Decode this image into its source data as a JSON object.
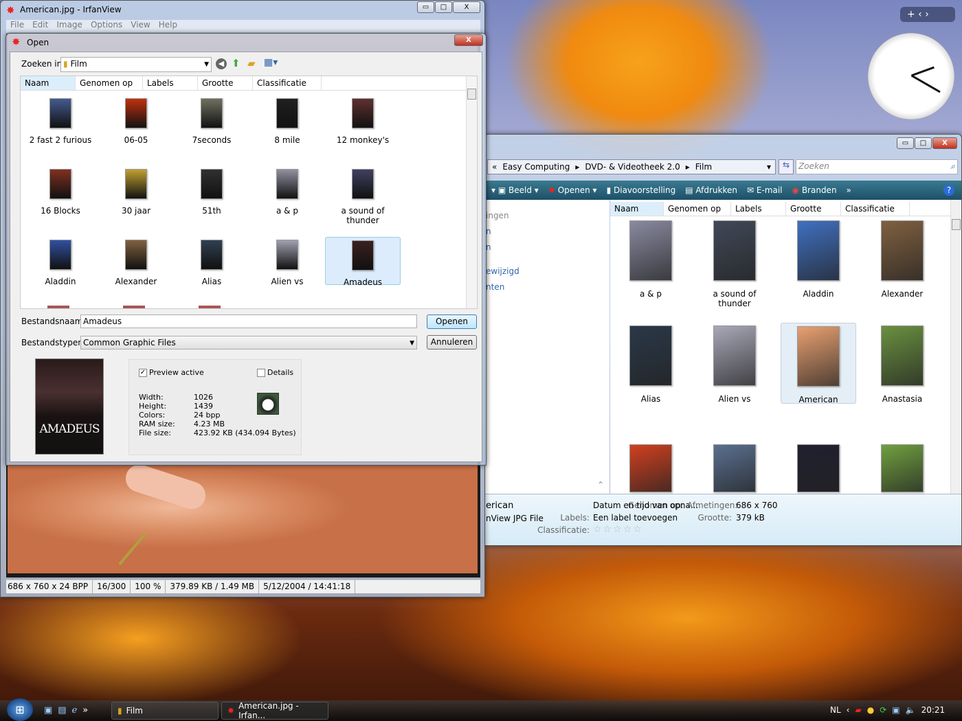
{
  "irfanview": {
    "title": "American.jpg - IrfanView",
    "menu": [
      "File",
      "Edit",
      "Image",
      "Options",
      "View",
      "Help"
    ],
    "status": [
      "686 x 760 x 24 BPP",
      "16/300",
      "100 %",
      "379.89 KB / 1.49 MB",
      "5/12/2004 / 14:41:18"
    ]
  },
  "open_dialog": {
    "title": "Open",
    "look_in_label": "Zoeken in:",
    "look_in_value": "Film",
    "columns": [
      "Naam",
      "Genomen op",
      "Labels",
      "Grootte",
      "Classificatie"
    ],
    "files": [
      {
        "name": "2 fast 2 furious",
        "color": "#445a90"
      },
      {
        "name": "06-05",
        "color": "#c03010"
      },
      {
        "name": "7seconds",
        "color": "#707060"
      },
      {
        "name": "8 mile",
        "color": "#202020"
      },
      {
        "name": "12 monkey's",
        "color": "#603030"
      },
      {
        "name": "16 Blocks",
        "color": "#803020"
      },
      {
        "name": "30 jaar",
        "color": "#c0a030"
      },
      {
        "name": "51th",
        "color": "#303030"
      },
      {
        "name": "a & p",
        "color": "#9090a0"
      },
      {
        "name": "a sound of thunder",
        "color": "#404060"
      },
      {
        "name": "Aladdin",
        "color": "#3050a0"
      },
      {
        "name": "Alexander",
        "color": "#806040"
      },
      {
        "name": "Alias",
        "color": "#304050"
      },
      {
        "name": "Alien vs",
        "color": "#a0a0b0"
      },
      {
        "name": "Amadeus",
        "color": "#3a2020",
        "selected": true
      }
    ],
    "filename_label": "Bestandsnaam:",
    "filename_value": "Amadeus",
    "filetype_label": "Bestandstypen:",
    "filetype_value": "Common Graphic Files",
    "open_button": "Openen",
    "cancel_button": "Annuleren",
    "preview_title": "AMADEUS",
    "preview_active_label": "Preview active",
    "preview_active": true,
    "details_label": "Details",
    "details": false,
    "info": [
      [
        "Width:",
        "1026"
      ],
      [
        "Height:",
        "1439"
      ],
      [
        "Colors:",
        "24 bpp"
      ],
      [
        "RAM size:",
        "4.23 MB"
      ],
      [
        "File size:",
        "423.92 KB (434.094 Bytes)"
      ]
    ]
  },
  "explorer": {
    "breadcrumb": [
      "Easy Computing",
      "DVD- & Videotheek 2.0",
      "Film"
    ],
    "search_placeholder": "Zoeken",
    "toolbar": [
      "Beeld",
      "Openen",
      "Diavoorstelling",
      "Afdrukken",
      "E-mail",
      "Branden"
    ],
    "sidebar": [
      "ingen",
      "n",
      "n",
      "ewijzigd",
      "nten"
    ],
    "columns": [
      "Naam",
      "Genomen op",
      "Labels",
      "Grootte",
      "Classificatie"
    ],
    "files": [
      {
        "name": "a & p",
        "color": "#8a8aa0"
      },
      {
        "name": "a sound of thunder",
        "color": "#404858"
      },
      {
        "name": "Aladdin",
        "color": "#4070c0"
      },
      {
        "name": "Alexander",
        "color": "#806040"
      },
      {
        "name": "Alias",
        "color": "#2a3848"
      },
      {
        "name": "Alien vs",
        "color": "#a8a8b8"
      },
      {
        "name": "American",
        "color": "#e8a070",
        "selected": true
      },
      {
        "name": "Anastasia",
        "color": "#6a9040"
      },
      {
        "name": "",
        "color": "#d04020"
      },
      {
        "name": "",
        "color": "#5a7090"
      },
      {
        "name": "",
        "color": "#202030"
      },
      {
        "name": "",
        "color": "#70a040"
      }
    ],
    "details": {
      "name": "erican",
      "type": "nView JPG File",
      "taken_label": "Genomen op:",
      "taken_value": "Datum en tijd van opna...",
      "dim_label": "Afmetingen:",
      "dim_value": "686 x 760",
      "labels_label": "Labels:",
      "labels_value": "Een label toevoegen",
      "size_label": "Grootte:",
      "size_value": "379 kB",
      "rating_label": "Classificatie:",
      "rating": 0
    }
  },
  "taskbar": {
    "tasks": [
      "Film",
      "American.jpg - Irfan..."
    ],
    "lang": "NL",
    "time": "20:21"
  }
}
